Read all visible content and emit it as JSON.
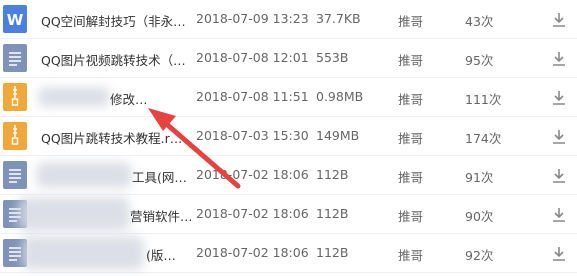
{
  "files": [
    {
      "icon": "word-icon",
      "name": "QQ空间解封技巧（非永…",
      "date": "2018-07-09 13:23",
      "size": "37.7KB",
      "uploader": "推哥",
      "downloads": "43次"
    },
    {
      "icon": "document-icon",
      "name": "QQ图片视频跳转技术（…",
      "date": "2018-07-08 12:01",
      "size": "553B",
      "uploader": "推哥",
      "downloads": "95次"
    },
    {
      "icon": "zip-icon",
      "name": "修改…",
      "date": "2018-07-08 11:51",
      "size": "0.98MB",
      "uploader": "推哥",
      "downloads": "111次"
    },
    {
      "icon": "zip-icon",
      "name": "QQ图片跳转技术教程.r…",
      "date": "2018-07-03 15:30",
      "size": "149MB",
      "uploader": "推哥",
      "downloads": "174次"
    },
    {
      "icon": "document-icon",
      "name": "工具(网…",
      "date": "2018-07-02 18:06",
      "size": "112B",
      "uploader": "推哥",
      "downloads": "91次"
    },
    {
      "icon": "document-icon",
      "name": "营销软件…",
      "date": "2018-07-02 18:06",
      "size": "112B",
      "uploader": "推哥",
      "downloads": "90次"
    },
    {
      "icon": "document-icon",
      "name": "(版…",
      "date": "2018-07-02 18:06",
      "size": "112B",
      "uploader": "推哥",
      "downloads": "92次"
    }
  ],
  "colors": {
    "accent_arrow": "#e8423f",
    "word": "#4b7fe0",
    "doc": "#7f92b7",
    "zip": "#f0a83b"
  }
}
